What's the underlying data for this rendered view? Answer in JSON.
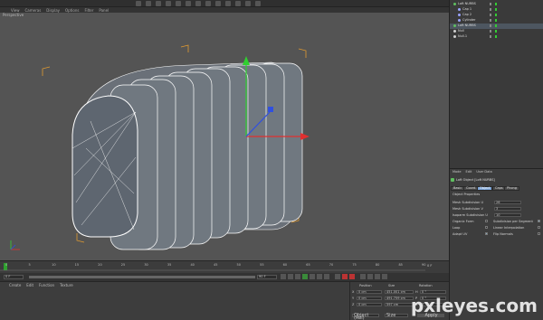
{
  "toolbar": {
    "items": [
      "Undo",
      "Redo",
      "Move",
      "Scale",
      "Rotate",
      "Render",
      "Cube",
      "Pen",
      "NURBS",
      "Array",
      "Deformer",
      "Light",
      "Camera"
    ]
  },
  "viewport": {
    "menu": [
      "View",
      "Cameras",
      "Display",
      "Options",
      "Filter",
      "Panel"
    ],
    "label": "Perspective"
  },
  "timeline": {
    "ticks": [
      "0",
      "5",
      "10",
      "15",
      "20",
      "25",
      "30",
      "35",
      "40",
      "45",
      "50",
      "55",
      "60",
      "65",
      "70",
      "75",
      "80",
      "85",
      "90"
    ],
    "end_label": "0 F",
    "start_field": "0 F",
    "end_field": "90 F"
  },
  "material_manager": {
    "menu": [
      "Create",
      "Edit",
      "Function",
      "Texture"
    ]
  },
  "coordinates": {
    "headers": [
      "Position",
      "Size",
      "Rotation"
    ],
    "rows": [
      {
        "axis": "X",
        "pos": "0 cm",
        "size": "451.001 cm",
        "rot_axis": "H",
        "rot": "0 °"
      },
      {
        "axis": "Y",
        "pos": "0 cm",
        "size": "491.759 cm",
        "rot_axis": "P",
        "rot": "0 °"
      },
      {
        "axis": "Z",
        "pos": "0 cm",
        "size": "597 cm",
        "rot_axis": "B",
        "rot": "0 °"
      }
    ],
    "mode_select": "Object (Rel)",
    "size_select": "Size",
    "apply_label": "Apply"
  },
  "object_manager": {
    "objects": [
      {
        "name": "Loft NURBS",
        "indent": 0,
        "color": "#5fbf5f",
        "selected": false
      },
      {
        "name": "Cap 1",
        "indent": 1,
        "color": "#9aa4ff",
        "selected": false
      },
      {
        "name": "Cap 2",
        "indent": 1,
        "color": "#9aa4ff",
        "selected": false
      },
      {
        "name": "Cylinder",
        "indent": 1,
        "color": "#9aa4ff",
        "selected": false
      },
      {
        "name": "Loft NURBS",
        "indent": 0,
        "color": "#5fbf5f",
        "selected": true
      },
      {
        "name": "Null",
        "indent": 0,
        "color": "#d0d0d0",
        "selected": false
      },
      {
        "name": "Null.1",
        "indent": 0,
        "color": "#d0d0d0",
        "selected": false
      }
    ]
  },
  "attribute_manager": {
    "menu": [
      "Mode",
      "Edit",
      "User Data"
    ],
    "object_title": "Loft Object [Loft NURBS]",
    "tabs": [
      "Basic",
      "Coord.",
      "Object",
      "Caps",
      "Phong"
    ],
    "active_tab": "Object",
    "section": "Object Properties",
    "props": [
      {
        "label": "Mesh Subdivision U",
        "value": "26"
      },
      {
        "label": "Mesh Subdivision V",
        "value": "3"
      },
      {
        "label": "Isoparm Subdivision U",
        "value": "10"
      }
    ],
    "checks": [
      {
        "label": "Organic Form",
        "checked": false,
        "label2": "Subdivision per Segment",
        "checked2": true
      },
      {
        "label": "Loop",
        "checked": false,
        "label2": "Linear Interpolation",
        "checked2": false
      },
      {
        "label": "Adapt UV",
        "checked": true,
        "label2": "Flip Normals",
        "checked2": false
      }
    ]
  },
  "watermark": "pxleyes.com",
  "colors": {
    "viewport_bg": "#545454",
    "wire": "#ffffff",
    "axis_x": "#e03030",
    "axis_y": "#30d030",
    "axis_z": "#3050e0",
    "bbox": "#e09a30",
    "selection": "#7da5d8"
  }
}
